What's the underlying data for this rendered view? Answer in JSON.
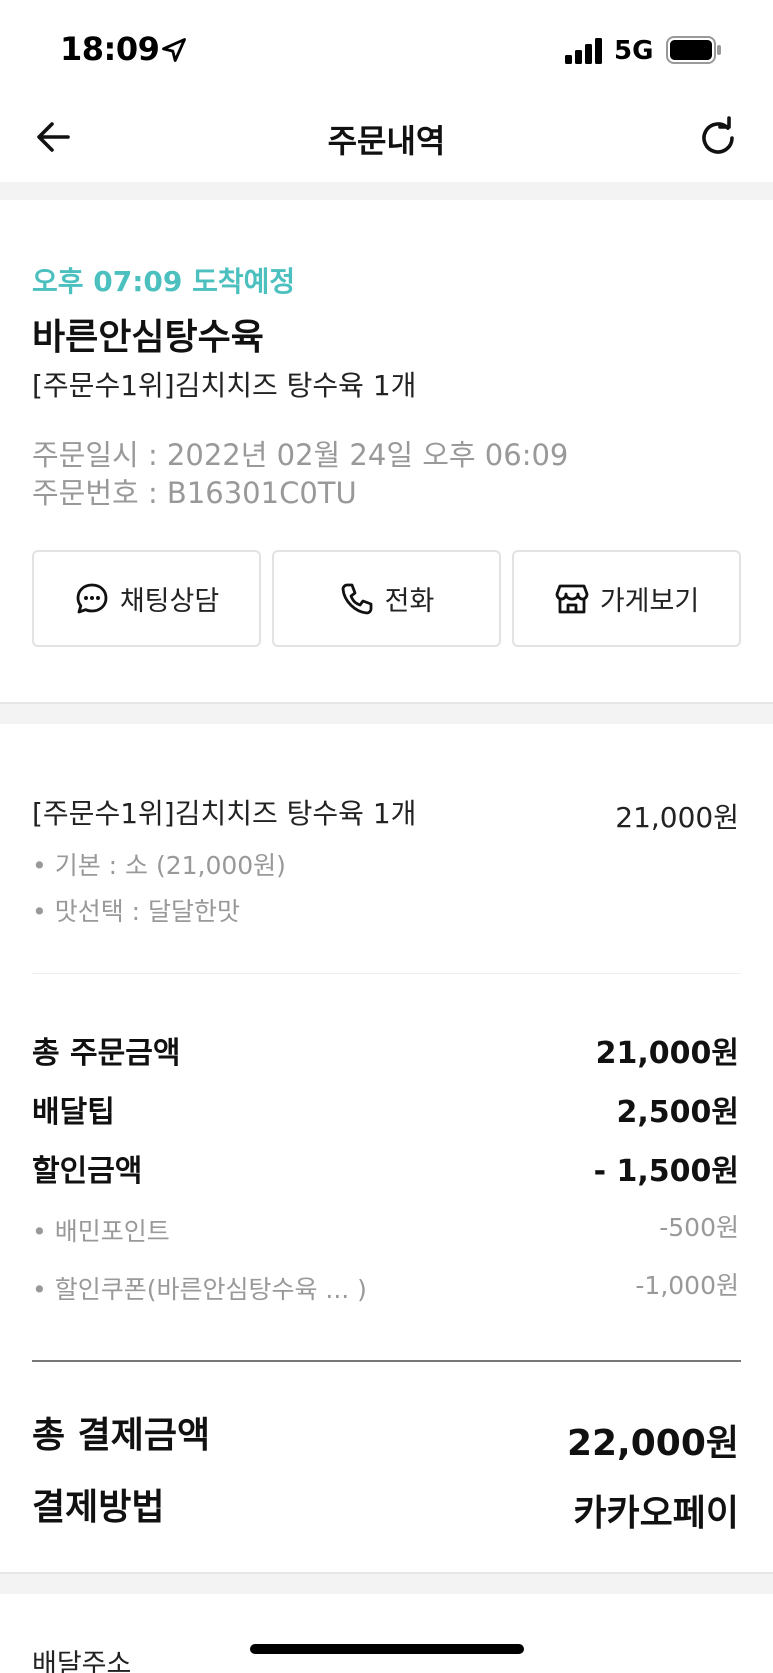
{
  "status_bar": {
    "time": "18:09",
    "network": "5G",
    "battery_icon": "battery-full-icon",
    "location_icon": "location-arrow-icon",
    "signal_icon": "signal-bars-icon"
  },
  "header": {
    "title": "주문내역",
    "back_icon": "back-arrow-icon",
    "refresh_icon": "refresh-icon"
  },
  "order": {
    "eta": "오후 07:09 도착예정",
    "store": "바른안심탕수육",
    "summary": "[주문수1위]김치치즈 탕수육 1개",
    "order_datetime": "주문일시 : 2022년 02월 24일 오후 06:09",
    "order_number": "주문번호 : B16301C0TU"
  },
  "actions": [
    {
      "label": "채팅상담",
      "icon": "chat-bubble-icon"
    },
    {
      "label": "전화",
      "icon": "phone-icon"
    },
    {
      "label": "가게보기",
      "icon": "store-icon"
    }
  ],
  "item": {
    "name": "[주문수1위]김치치즈 탕수육 1개",
    "price": "21,000원",
    "options": [
      "• 기본 : 소 (21,000원)",
      "• 맛선택 : 달달한맛"
    ]
  },
  "summary_rows": [
    {
      "label": "총 주문금액",
      "value": "21,000원"
    },
    {
      "label": "배달팁",
      "value": "2,500원"
    },
    {
      "label": "할인금액",
      "value": "- 1,500원"
    }
  ],
  "discounts": [
    {
      "label": "• 배민포인트",
      "value": "-500원"
    },
    {
      "label": "• 할인쿠폰(바른안심탕수육 ... )",
      "value": "-1,000원"
    }
  ],
  "payment": {
    "total_label": "총 결제금액",
    "total_value": "22,000원",
    "method_label": "결제방법",
    "method_value": "카카오페이"
  },
  "address_label": "배달주소",
  "colors": {
    "accent": "#4cbfbf",
    "muted": "#999999",
    "band": "#f3f3f3"
  }
}
